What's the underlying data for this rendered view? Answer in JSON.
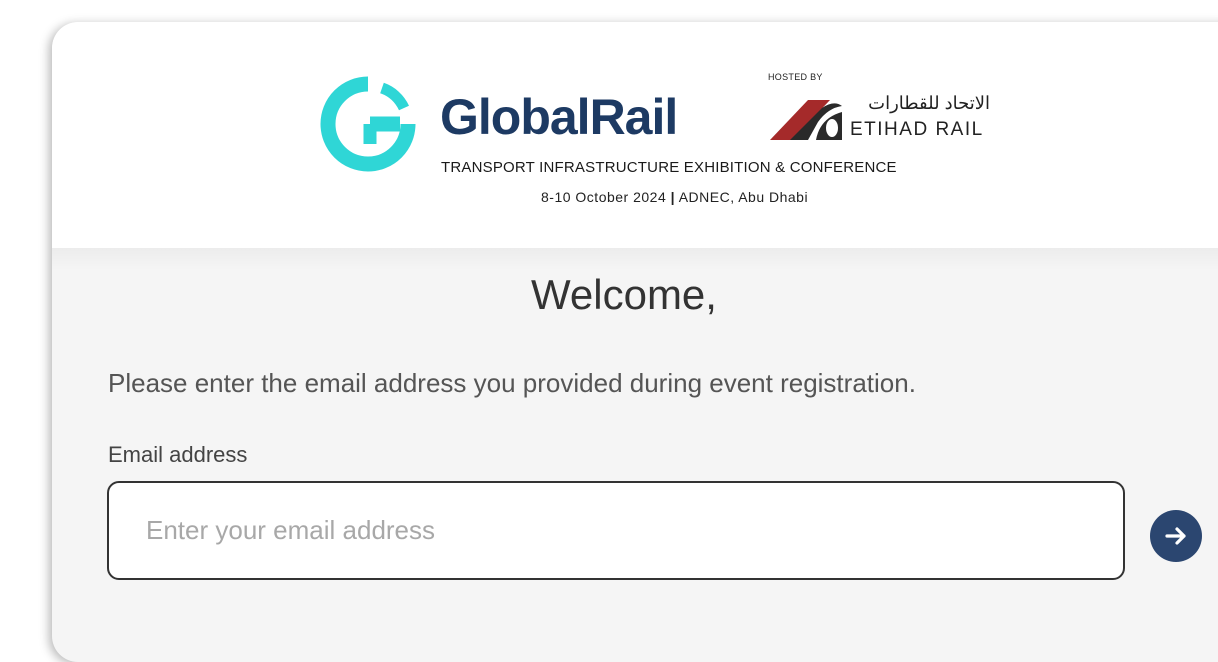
{
  "header": {
    "brand_name": "GlobalRail",
    "hosted_by": "HOSTED BY",
    "host_arabic": "الاتحاد للقطارات",
    "host_english": "ETIHAD RAIL",
    "tagline": "TRANSPORT INFRASTRUCTURE EXHIBITION & CONFERENCE",
    "dates": "8-10 October 2024",
    "separator": "|",
    "venue": "ADNEC, Abu Dhabi"
  },
  "main": {
    "welcome": "Welcome,",
    "instruction": "Please enter the email address you provided during event registration.",
    "email_label": "Email address",
    "email_value": "",
    "email_placeholder": "Enter your email address"
  },
  "icons": {
    "brand_logo": "globalrail-g-logo",
    "host_logo": "etihad-rail-logo",
    "submit": "arrow-right-icon"
  },
  "colors": {
    "brand_cyan": "#2fd6d6",
    "brand_navy": "#1d3a63",
    "button": "#2b4670",
    "etihad_red": "#a52a2a"
  }
}
